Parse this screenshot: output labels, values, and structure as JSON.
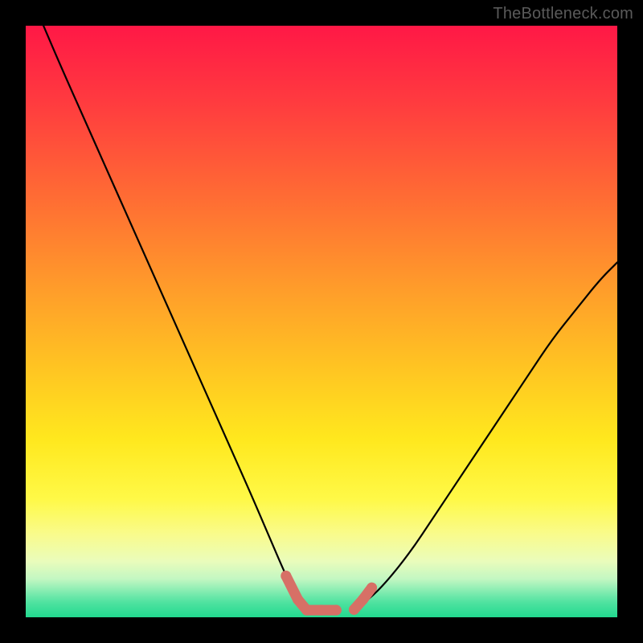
{
  "watermark": "TheBottleneck.com",
  "chart_data": {
    "type": "line",
    "title": "",
    "xlabel": "",
    "ylabel": "",
    "xlim": [
      0,
      100
    ],
    "ylim": [
      0,
      100
    ],
    "grid": false,
    "series": [
      {
        "name": "left-curve",
        "color": "#000000",
        "x": [
          3,
          6,
          10,
          14,
          18,
          22,
          26,
          30,
          34,
          38,
          41,
          44,
          46,
          48
        ],
        "y": [
          100,
          93,
          84,
          75,
          66,
          57,
          48,
          39,
          30,
          21,
          14,
          7,
          3,
          1
        ]
      },
      {
        "name": "right-curve",
        "color": "#000000",
        "x": [
          55,
          58,
          61,
          65,
          69,
          73,
          77,
          81,
          85,
          89,
          93,
          97,
          100
        ],
        "y": [
          1,
          3,
          6,
          11,
          17,
          23,
          29,
          35,
          41,
          47,
          52,
          57,
          60
        ]
      },
      {
        "name": "bottleneck-markers-left",
        "color": "#d77066",
        "x": [
          44,
          46,
          47.5,
          50,
          52.5
        ],
        "y": [
          7,
          3,
          1.2,
          1.2,
          1.2
        ]
      },
      {
        "name": "bottleneck-markers-right",
        "color": "#d77066",
        "x": [
          55.5,
          57,
          58.5
        ],
        "y": [
          1.3,
          3,
          5
        ]
      }
    ],
    "background_gradient_stops": [
      {
        "offset": 0.0,
        "color": "#ff1846"
      },
      {
        "offset": 0.13,
        "color": "#ff3b3f"
      },
      {
        "offset": 0.3,
        "color": "#ff6f33"
      },
      {
        "offset": 0.45,
        "color": "#ff9e2a"
      },
      {
        "offset": 0.58,
        "color": "#ffc522"
      },
      {
        "offset": 0.7,
        "color": "#ffe81e"
      },
      {
        "offset": 0.8,
        "color": "#fff947"
      },
      {
        "offset": 0.86,
        "color": "#f9fb8c"
      },
      {
        "offset": 0.905,
        "color": "#eafcbb"
      },
      {
        "offset": 0.935,
        "color": "#c3f7c2"
      },
      {
        "offset": 0.955,
        "color": "#88edb2"
      },
      {
        "offset": 0.975,
        "color": "#4fe2a0"
      },
      {
        "offset": 1.0,
        "color": "#22d98f"
      }
    ]
  }
}
